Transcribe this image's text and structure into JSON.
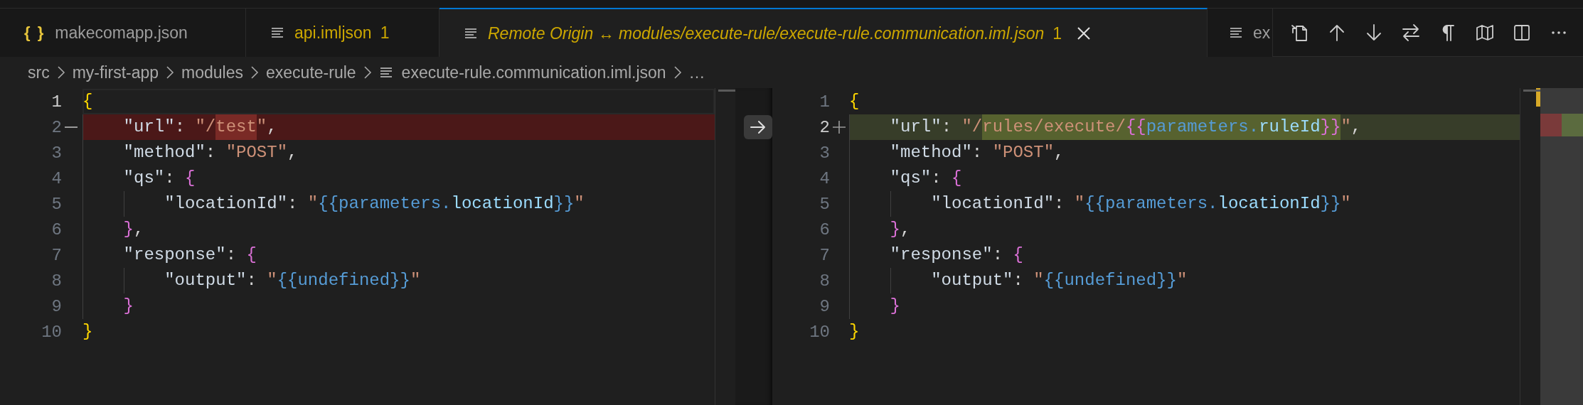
{
  "tabs": [
    {
      "glyph": "{ }",
      "label": "makecomapp.json",
      "selected": false,
      "preview": false,
      "warning": false
    },
    {
      "label": "api.imljson",
      "problems": "1",
      "selected": false,
      "preview": false,
      "warning": true
    },
    {
      "label": "Remote Origin ↔ modules/execute-rule/execute-rule.communication.iml.json",
      "problems": "1",
      "selected": true,
      "preview": true,
      "warning": true
    },
    {
      "label": "ex",
      "selected": false,
      "preview": false,
      "warning": false
    }
  ],
  "breadcrumbs": [
    {
      "kind": "folder",
      "label": "src"
    },
    {
      "kind": "folder",
      "label": "my-first-app"
    },
    {
      "kind": "folder",
      "label": "modules"
    },
    {
      "kind": "folder",
      "label": "execute-rule"
    },
    {
      "kind": "file",
      "label": "execute-rule.communication.iml.json"
    },
    {
      "kind": "more",
      "label": "…"
    }
  ],
  "left_pane": {
    "lines": [
      {
        "number": "1",
        "current": true,
        "kind": "plain",
        "segments": [
          {
            "changed": false,
            "tokens": [
              {
                "kind": "brace-outer",
                "text": "{"
              }
            ]
          }
        ]
      },
      {
        "number": "2",
        "current": false,
        "kind": "removed",
        "segments": [
          {
            "changed": false,
            "tokens": [
              {
                "kind": "key",
                "text": "    \"url\""
              },
              {
                "kind": "punct",
                "text": ": "
              },
              {
                "kind": "string",
                "text": "\"/"
              }
            ]
          },
          {
            "changed": true,
            "tokens": [
              {
                "kind": "string",
                "text": "test"
              }
            ]
          },
          {
            "changed": false,
            "tokens": [
              {
                "kind": "string",
                "text": "\""
              },
              {
                "kind": "punct",
                "text": ","
              }
            ]
          }
        ]
      },
      {
        "number": "3",
        "current": false,
        "kind": "plain",
        "segments": [
          {
            "changed": false,
            "tokens": [
              {
                "kind": "key",
                "text": "    \"method\""
              },
              {
                "kind": "punct",
                "text": ": "
              },
              {
                "kind": "string",
                "text": "\"POST\""
              },
              {
                "kind": "punct",
                "text": ","
              }
            ]
          }
        ]
      },
      {
        "number": "4",
        "current": false,
        "kind": "plain",
        "segments": [
          {
            "changed": false,
            "tokens": [
              {
                "kind": "key",
                "text": "    \"qs\""
              },
              {
                "kind": "punct",
                "text": ": "
              },
              {
                "kind": "brace-inner",
                "text": "{"
              }
            ]
          }
        ]
      },
      {
        "number": "5",
        "current": false,
        "kind": "plain",
        "segments": [
          {
            "changed": false,
            "tokens": [
              {
                "kind": "key",
                "text": "        \"locationId\""
              },
              {
                "kind": "punct",
                "text": ": "
              },
              {
                "kind": "string",
                "text": "\""
              },
              {
                "kind": "template-brace",
                "text": "{{"
              },
              {
                "kind": "template",
                "text": "parameters."
              },
              {
                "kind": "template-var",
                "text": "locationId"
              },
              {
                "kind": "template-brace",
                "text": "}}"
              },
              {
                "kind": "string",
                "text": "\""
              }
            ]
          }
        ]
      },
      {
        "number": "6",
        "current": false,
        "kind": "plain",
        "segments": [
          {
            "changed": false,
            "tokens": [
              {
                "kind": "brace-inner",
                "text": "    }"
              },
              {
                "kind": "punct",
                "text": ","
              }
            ]
          }
        ]
      },
      {
        "number": "7",
        "current": false,
        "kind": "plain",
        "segments": [
          {
            "changed": false,
            "tokens": [
              {
                "kind": "key",
                "text": "    \"response\""
              },
              {
                "kind": "punct",
                "text": ": "
              },
              {
                "kind": "brace-inner",
                "text": "{"
              }
            ]
          }
        ]
      },
      {
        "number": "8",
        "current": false,
        "kind": "plain",
        "segments": [
          {
            "changed": false,
            "tokens": [
              {
                "kind": "key",
                "text": "        \"output\""
              },
              {
                "kind": "punct",
                "text": ": "
              },
              {
                "kind": "string",
                "text": "\""
              },
              {
                "kind": "template-brace",
                "text": "{{"
              },
              {
                "kind": "template",
                "text": "undefined"
              },
              {
                "kind": "template-brace",
                "text": "}}"
              },
              {
                "kind": "string",
                "text": "\""
              }
            ]
          }
        ]
      },
      {
        "number": "9",
        "current": false,
        "kind": "plain",
        "segments": [
          {
            "changed": false,
            "tokens": [
              {
                "kind": "brace-inner",
                "text": "    }"
              }
            ]
          }
        ]
      },
      {
        "number": "10",
        "current": false,
        "kind": "plain",
        "segments": [
          {
            "changed": false,
            "tokens": [
              {
                "kind": "brace-outer",
                "text": "}"
              }
            ]
          }
        ]
      }
    ]
  },
  "right_pane": {
    "lines": [
      {
        "number": "1",
        "current": false,
        "kind": "plain",
        "segments": [
          {
            "changed": false,
            "tokens": [
              {
                "kind": "brace-outer",
                "text": "{"
              }
            ]
          }
        ]
      },
      {
        "number": "2",
        "current": true,
        "kind": "added",
        "segments": [
          {
            "changed": false,
            "tokens": [
              {
                "kind": "key",
                "text": "    \"url\""
              },
              {
                "kind": "punct",
                "text": ": "
              },
              {
                "kind": "string",
                "text": "\"/"
              }
            ]
          },
          {
            "changed": true,
            "tokens": [
              {
                "kind": "string",
                "text": "rules/execute/"
              },
              {
                "kind": "brace-inner",
                "text": "{{"
              },
              {
                "kind": "template",
                "text": "parameters."
              },
              {
                "kind": "template-var",
                "text": "ruleId"
              },
              {
                "kind": "brace-inner",
                "text": "}}"
              }
            ]
          },
          {
            "changed": false,
            "tokens": [
              {
                "kind": "string",
                "text": "\""
              },
              {
                "kind": "punct",
                "text": ","
              }
            ]
          }
        ]
      },
      {
        "number": "3",
        "current": false,
        "kind": "plain",
        "segments": [
          {
            "changed": false,
            "tokens": [
              {
                "kind": "key",
                "text": "    \"method\""
              },
              {
                "kind": "punct",
                "text": ": "
              },
              {
                "kind": "string",
                "text": "\"POST\""
              },
              {
                "kind": "punct",
                "text": ","
              }
            ]
          }
        ]
      },
      {
        "number": "4",
        "current": false,
        "kind": "plain",
        "segments": [
          {
            "changed": false,
            "tokens": [
              {
                "kind": "key",
                "text": "    \"qs\""
              },
              {
                "kind": "punct",
                "text": ": "
              },
              {
                "kind": "brace-inner",
                "text": "{"
              }
            ]
          }
        ]
      },
      {
        "number": "5",
        "current": false,
        "kind": "plain",
        "segments": [
          {
            "changed": false,
            "tokens": [
              {
                "kind": "key",
                "text": "        \"locationId\""
              },
              {
                "kind": "punct",
                "text": ": "
              },
              {
                "kind": "string",
                "text": "\""
              },
              {
                "kind": "template-brace",
                "text": "{{"
              },
              {
                "kind": "template",
                "text": "parameters."
              },
              {
                "kind": "template-var",
                "text": "locationId"
              },
              {
                "kind": "template-brace",
                "text": "}}"
              },
              {
                "kind": "string",
                "text": "\""
              }
            ]
          }
        ]
      },
      {
        "number": "6",
        "current": false,
        "kind": "plain",
        "segments": [
          {
            "changed": false,
            "tokens": [
              {
                "kind": "brace-inner",
                "text": "    }"
              },
              {
                "kind": "punct",
                "text": ","
              }
            ]
          }
        ]
      },
      {
        "number": "7",
        "current": false,
        "kind": "plain",
        "segments": [
          {
            "changed": false,
            "tokens": [
              {
                "kind": "key",
                "text": "    \"response\""
              },
              {
                "kind": "punct",
                "text": ": "
              },
              {
                "kind": "brace-inner",
                "text": "{"
              }
            ]
          }
        ]
      },
      {
        "number": "8",
        "current": false,
        "kind": "plain",
        "segments": [
          {
            "changed": false,
            "tokens": [
              {
                "kind": "key",
                "text": "        \"output\""
              },
              {
                "kind": "punct",
                "text": ": "
              },
              {
                "kind": "string",
                "text": "\""
              },
              {
                "kind": "template-brace",
                "text": "{{"
              },
              {
                "kind": "template",
                "text": "undefined"
              },
              {
                "kind": "template-brace",
                "text": "}}"
              },
              {
                "kind": "string",
                "text": "\""
              }
            ]
          }
        ]
      },
      {
        "number": "9",
        "current": false,
        "kind": "plain",
        "segments": [
          {
            "changed": false,
            "tokens": [
              {
                "kind": "brace-inner",
                "text": "    }"
              }
            ]
          }
        ]
      },
      {
        "number": "10",
        "current": false,
        "kind": "plain",
        "segments": [
          {
            "changed": false,
            "tokens": [
              {
                "kind": "brace-outer",
                "text": "}"
              }
            ]
          }
        ]
      }
    ]
  }
}
